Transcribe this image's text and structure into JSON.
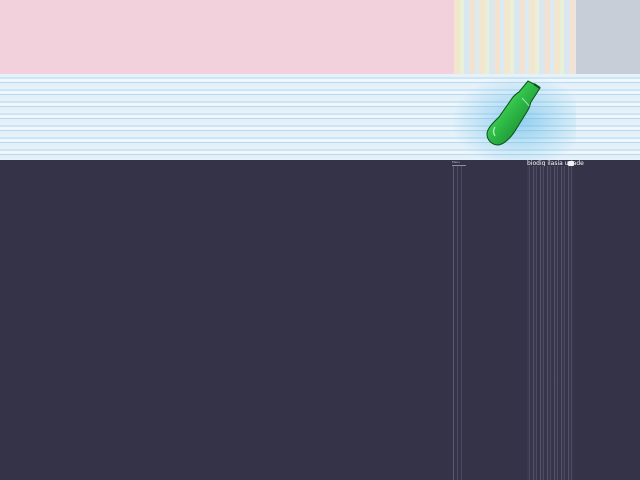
{
  "header": {
    "site_title": "biodiq ilasia uriade"
  },
  "sidebar": {
    "mini_label": "Menu",
    "mini_sub": ""
  },
  "icons": {
    "badge_icon": "square-icon",
    "hero_image": "green-bottle"
  },
  "colors": {
    "top_band": "#f2d1dc",
    "mid_band": "#cfe5f4",
    "dark_bg": "#343348",
    "bottle_green": "#25b24a"
  }
}
